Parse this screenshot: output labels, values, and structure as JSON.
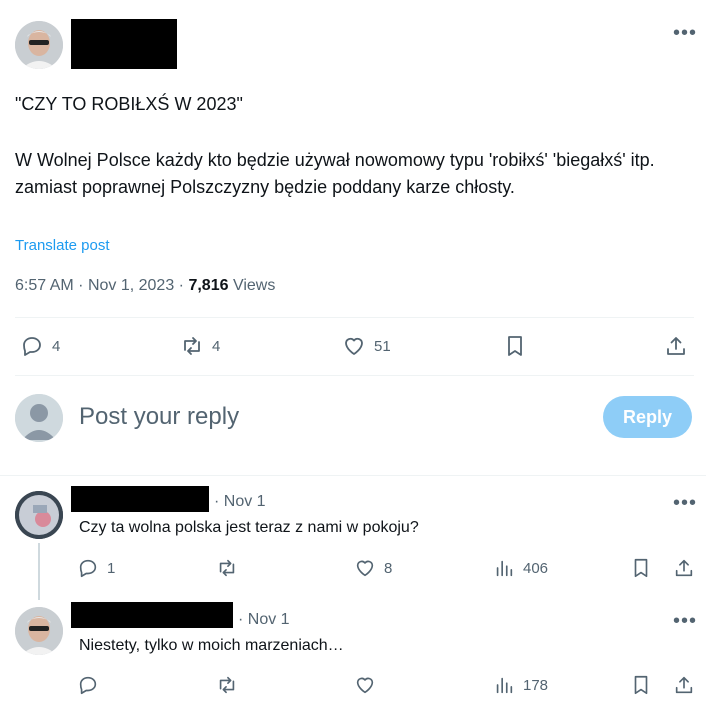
{
  "tweet": {
    "headline": "\"CZY TO ROBIŁXŚ W 2023\"",
    "body": "W Wolnej Polsce każdy kto będzie używał nowomowy typu 'robiłxś' 'biegałxś' itp. zamiast poprawnej Polszczyzny będzie poddany karze chłosty.",
    "translate": "Translate post",
    "time": "6:57 AM",
    "date": "Nov 1, 2023",
    "views_count": "7,816",
    "views_label": "Views",
    "actions": {
      "replies": "4",
      "reposts": "4",
      "likes": "51"
    }
  },
  "composer": {
    "placeholder": "Post your reply",
    "button": "Reply"
  },
  "replies": [
    {
      "date": "· Nov 1",
      "text": "Czy ta wolna polska jest teraz z nami w pokoju?",
      "actions": {
        "replies": "1",
        "reposts": "",
        "likes": "8",
        "views": "406"
      }
    },
    {
      "date": "· Nov 1",
      "text": "Niestety, tylko w moich marzeniach…",
      "actions": {
        "replies": "",
        "reposts": "",
        "likes": "",
        "views": "178"
      }
    }
  ],
  "icons": [
    "more-icon",
    "reply-icon",
    "repost-icon",
    "like-icon",
    "bookmark-icon",
    "share-icon",
    "views-icon"
  ],
  "colors": {
    "link": "#1d9bf0",
    "reply_button": "#8ecdf7",
    "muted": "#536471"
  }
}
